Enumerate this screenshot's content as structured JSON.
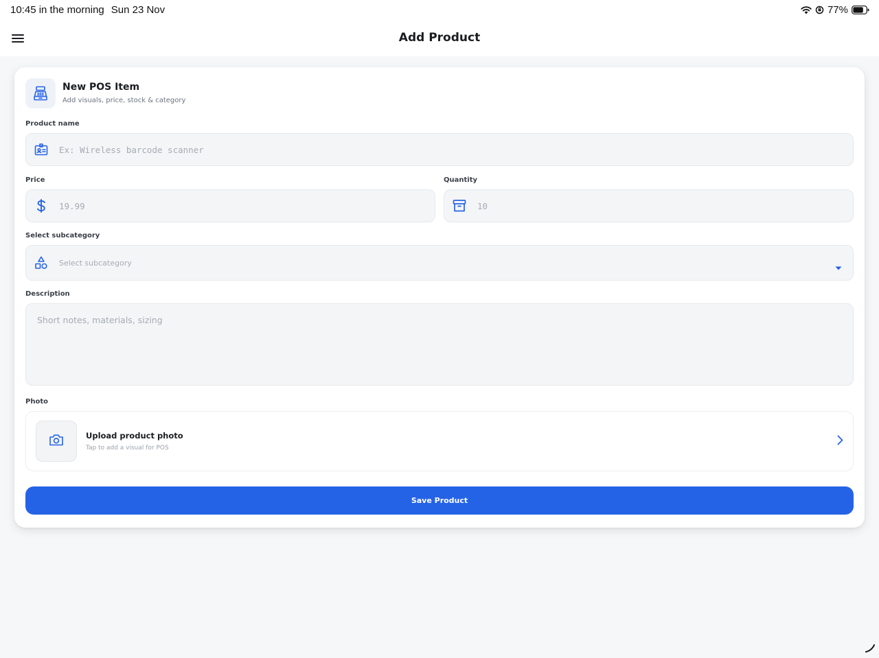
{
  "status_bar": {
    "time": "10:45 in the morning",
    "date": "Sun 23 Nov",
    "battery": "77%",
    "icons": [
      "wifi-icon",
      "orientation-lock-icon",
      "battery-icon"
    ]
  },
  "header": {
    "title": "Add Product",
    "menu_icon": "hamburger-menu-icon"
  },
  "form": {
    "card_title": "New POS Item",
    "card_subtitle": "Add visuals, price, stock & category",
    "card_icon": "cash-register-icon",
    "product_name": {
      "label": "Product name",
      "placeholder": "Ex: Wireless barcode scanner",
      "value": "",
      "icon": "id-card-icon"
    },
    "price": {
      "label": "Price",
      "placeholder": "19.99",
      "value": "",
      "icon": "dollar-icon"
    },
    "quantity": {
      "label": "Quantity",
      "placeholder": "10",
      "value": "",
      "icon": "archive-box-icon"
    },
    "subcategory": {
      "label": "Select subcategory",
      "selected": "Select subcategory",
      "icon": "shapes-icon"
    },
    "description": {
      "label": "Description",
      "placeholder": "Short notes, materials, sizing",
      "value": ""
    },
    "photo": {
      "label": "Photo",
      "title": "Upload product photo",
      "subtitle": "Tap to add a visual for POS",
      "icon": "camera-icon"
    },
    "save_label": "Save Product"
  },
  "colors": {
    "accent": "#2563e6",
    "background": "#f6f7f9",
    "field_bg": "#f4f5f7",
    "placeholder": "#a5abb4"
  }
}
